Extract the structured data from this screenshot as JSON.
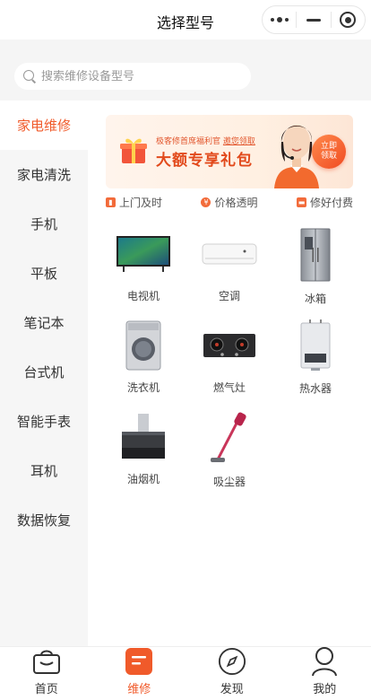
{
  "header": {
    "title": "选择型号"
  },
  "search": {
    "placeholder": "搜索维修设备型号"
  },
  "sidebar": {
    "items": [
      {
        "label": "家电维修",
        "active": true
      },
      {
        "label": "家电清洗"
      },
      {
        "label": "手机"
      },
      {
        "label": "平板"
      },
      {
        "label": "笔记本"
      },
      {
        "label": "台式机"
      },
      {
        "label": "智能手表"
      },
      {
        "label": "耳机"
      },
      {
        "label": "数据恢复"
      }
    ]
  },
  "banner": {
    "small_text_a": "极客修首席福利官",
    "small_text_b": "邀您领取",
    "big_text": "大额专享礼包",
    "claim_line1": "立即",
    "claim_line2": "领取"
  },
  "features": [
    {
      "label": "上门及时",
      "icon": "door-icon"
    },
    {
      "label": "价格透明",
      "icon": "yen-icon"
    },
    {
      "label": "修好付费",
      "icon": "card-icon"
    }
  ],
  "products": [
    {
      "label": "电视机",
      "icon": "tv"
    },
    {
      "label": "空调",
      "icon": "air-conditioner"
    },
    {
      "label": "冰箱",
      "icon": "fridge"
    },
    {
      "label": "洗衣机",
      "icon": "washer"
    },
    {
      "label": "燃气灶",
      "icon": "gas-stove"
    },
    {
      "label": "热水器",
      "icon": "water-heater"
    },
    {
      "label": "油烟机",
      "icon": "range-hood"
    },
    {
      "label": "吸尘器",
      "icon": "vacuum"
    }
  ],
  "tabbar": [
    {
      "label": "首页"
    },
    {
      "label": "维修",
      "active": true
    },
    {
      "label": "发现"
    },
    {
      "label": "我的"
    }
  ],
  "colors": {
    "accent": "#f05a2a",
    "sidebar_bg": "#f6f6f6"
  }
}
